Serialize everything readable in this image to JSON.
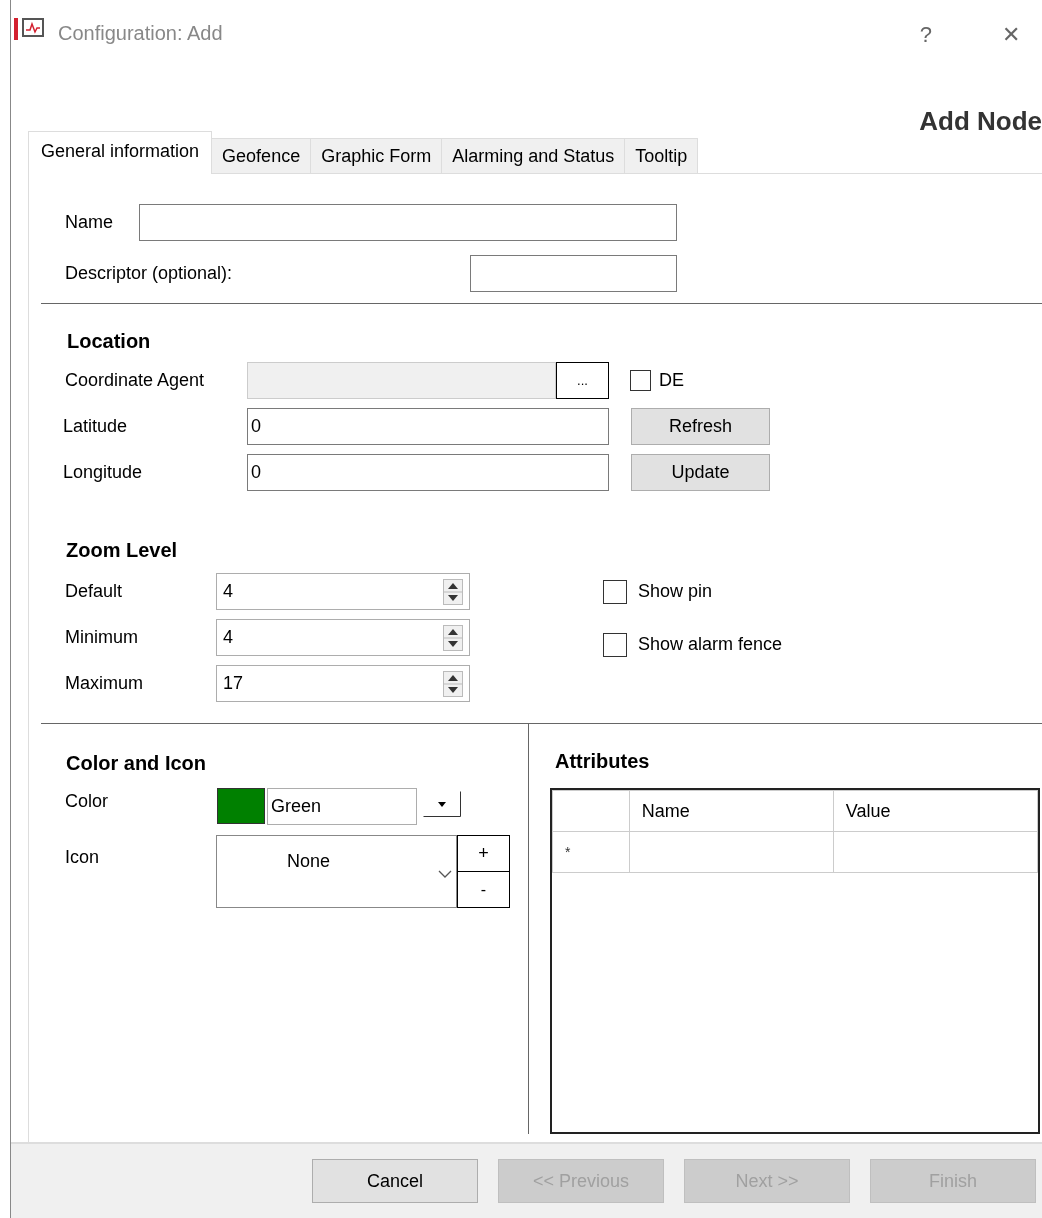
{
  "window": {
    "title": "Configuration: Add",
    "help": "?",
    "close": "✕"
  },
  "heading": "Add Node",
  "tabs": [
    {
      "label": "General information",
      "selected": true
    },
    {
      "label": "Geofence",
      "selected": false
    },
    {
      "label": "Graphic Form",
      "selected": false
    },
    {
      "label": "Alarming and Status",
      "selected": false
    },
    {
      "label": "Tooltip",
      "selected": false
    }
  ],
  "general": {
    "name": {
      "label": "Name"
    },
    "descriptor": {
      "label": "Descriptor (optional):"
    }
  },
  "location": {
    "title": "Location",
    "coordinate_agent": {
      "label": "Coordinate Agent",
      "disabled": true,
      "browse": "..."
    },
    "de": {
      "label": "DE",
      "checked": false
    },
    "fields": [
      {
        "label": "Latitude",
        "value": "0",
        "button": "Refresh"
      },
      {
        "label": "Longitude",
        "value": "0",
        "button": "Update"
      }
    ]
  },
  "zoom": {
    "title": "Zoom Level",
    "spinners": [
      {
        "label": "Default",
        "value": "4"
      },
      {
        "label": "Minimum",
        "value": "4"
      },
      {
        "label": "Maximum",
        "value": "17"
      }
    ],
    "checkboxes": [
      {
        "label": "Show pin",
        "checked": false
      },
      {
        "label": "Show alarm fence",
        "checked": false
      }
    ]
  },
  "color_icon": {
    "title": "Color and Icon",
    "color_label": "Color",
    "color": {
      "name": "Green",
      "color": "#008000"
    },
    "icon_label": "Icon",
    "icon": "None",
    "add": "+",
    "remove": "-"
  },
  "attributes": {
    "title": "Attributes",
    "columns": [
      "Name",
      "Value"
    ],
    "new_row_marker": "*"
  },
  "footer": [
    {
      "label": "Cancel",
      "disabled": false
    },
    {
      "label": "<< Previous",
      "disabled": true
    },
    {
      "label": "Next >>",
      "disabled": true
    },
    {
      "label": "Finish",
      "disabled": true
    }
  ]
}
